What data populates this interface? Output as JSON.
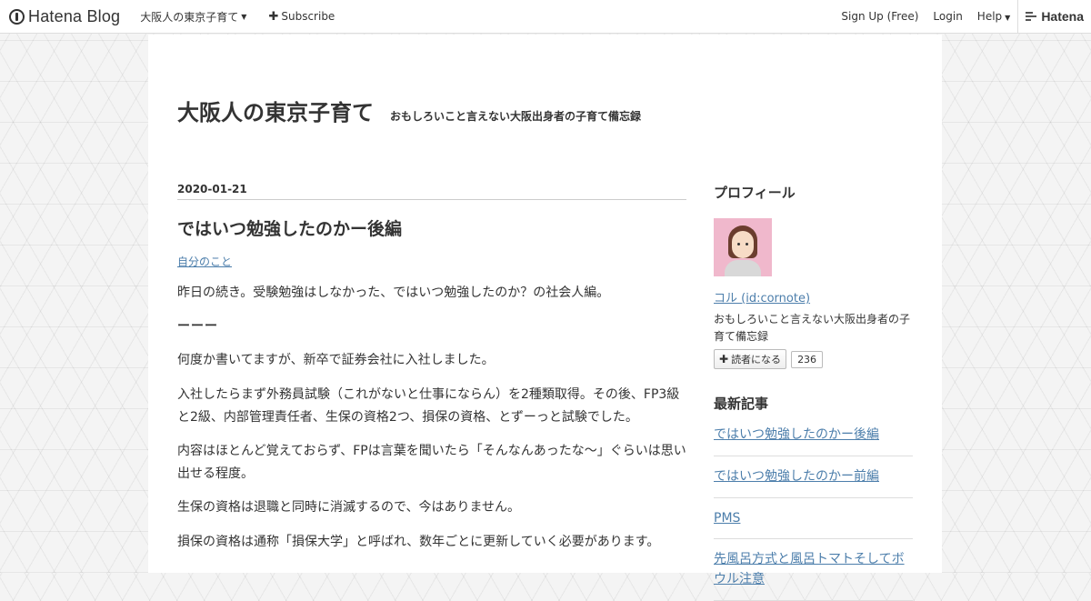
{
  "globalheader": {
    "logo_text": "Hatena Blog",
    "blog_name": "大阪人の東京子育て",
    "subscribe_label": "Subscribe",
    "signup_label": "Sign Up (Free)",
    "login_label": "Login",
    "help_label": "Help",
    "hatena_label": "Hatena"
  },
  "blog": {
    "title": "大阪人の東京子育て",
    "description": "おもしろいこと言えない大阪出身者の子育て備忘録"
  },
  "entry": {
    "date": "2020-01-21",
    "title": "ではいつ勉強したのかー後編",
    "category": "自分のこと",
    "paragraphs": [
      "昨日の続き。受験勉強はしなかった、ではいつ勉強したのか？の社会人編。",
      "ーーー",
      "何度か書いてますが、新卒で証券会社に入社しました。",
      "入社したらまず外務員試験（これがないと仕事にならん）を2種類取得。その後、FP3級と2級、内部管理責任者、生保の資格2つ、損保の資格、とずーっと試験でした。",
      "内容はほとんど覚えておらず、FPは言葉を聞いたら「そんなんあったな〜」ぐらいは思い出せる程度。",
      "生保の資格は退職と同時に消滅するので、今はありません。",
      "損保の資格は通称「損保大学」と呼ばれ、数年ごとに更新していく必要があります。"
    ]
  },
  "sidebar": {
    "profile_title": "プロフィール",
    "user_name": "コル (id:cornote)",
    "user_description": "おもしろいこと言えない大阪出身者の子育て備忘録",
    "reader_button_label": "読者になる",
    "reader_count": "236",
    "recent_title": "最新記事",
    "recent_entries": [
      "ではいつ勉強したのかー後編",
      "ではいつ勉強したのかー前編",
      "PMS",
      "先風呂方式と風呂トマトそしてボウル注意"
    ]
  }
}
